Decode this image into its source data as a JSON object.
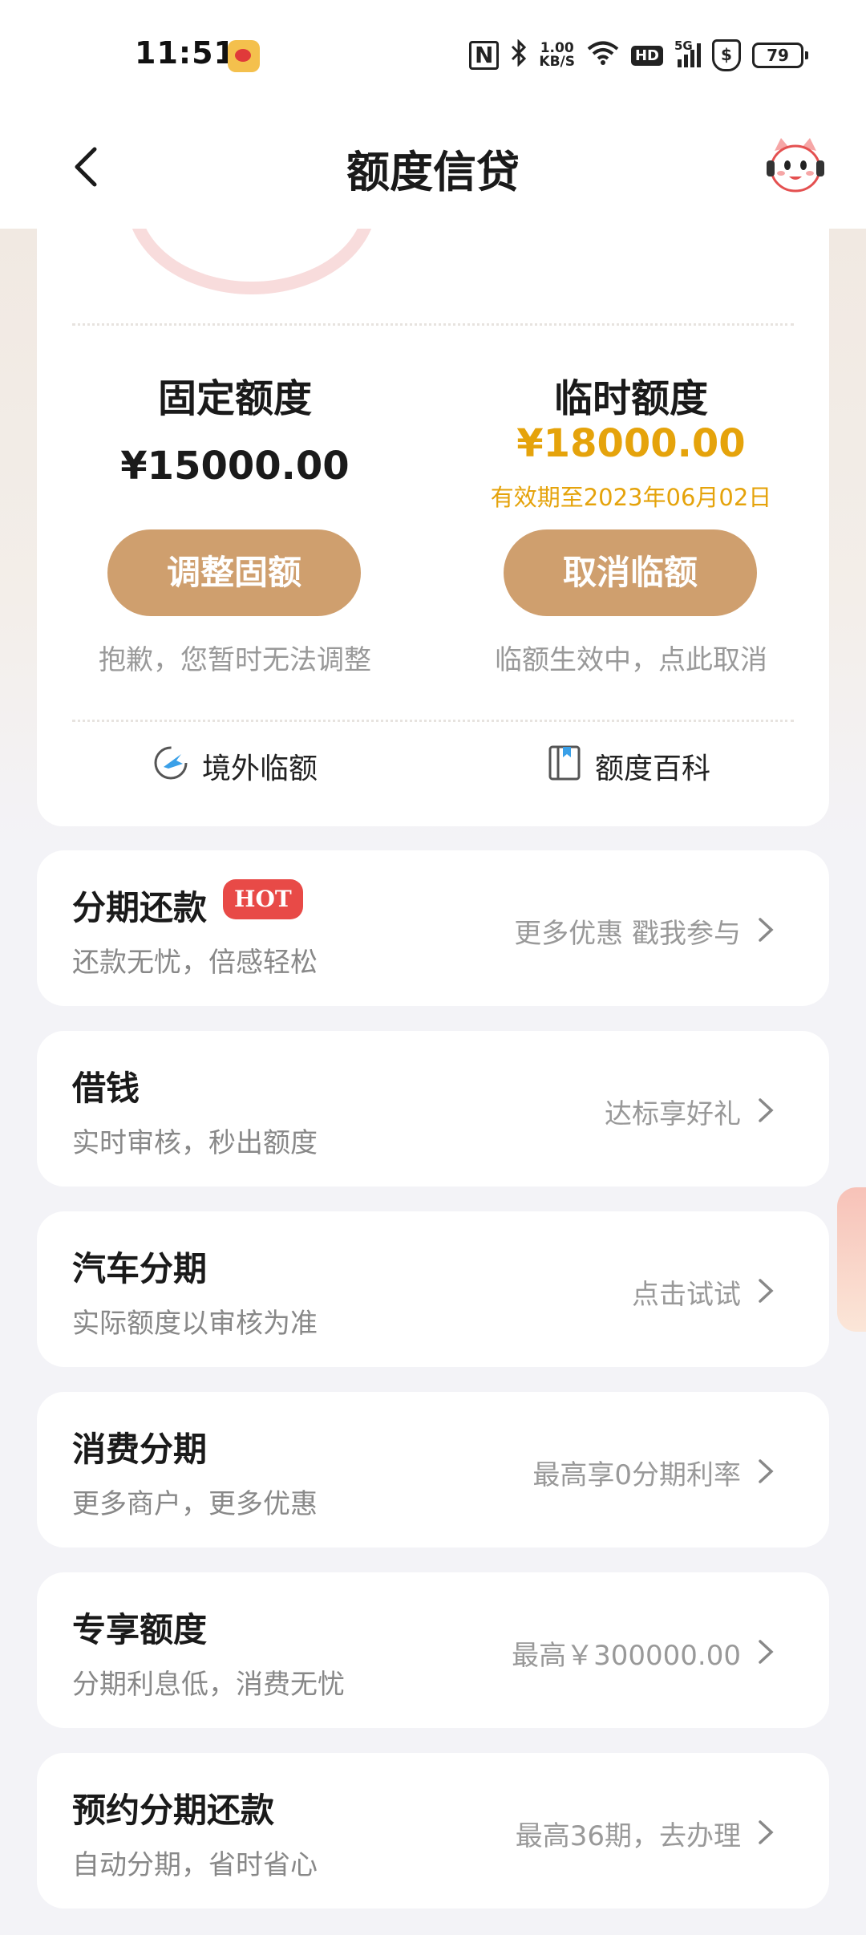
{
  "status_bar": {
    "time": "11:51",
    "net_speed_value": "1.00",
    "net_speed_unit": "KB/S",
    "hd": "HD",
    "network": "5G",
    "battery": "79"
  },
  "nav": {
    "title": "额度信贷"
  },
  "quota": {
    "fixed": {
      "label": "固定额度",
      "amount": "¥15000.00",
      "button": "调整固额",
      "hint": "抱歉，您暂时无法调整"
    },
    "temp": {
      "label": "临时额度",
      "amount": "¥18000.00",
      "valid": "有效期至2023年06月02日",
      "button": "取消临额",
      "hint": "临额生效中，点此取消"
    },
    "tools": [
      {
        "label": "境外临额",
        "icon": "plane-globe-icon"
      },
      {
        "label": "额度百科",
        "icon": "book-icon"
      }
    ]
  },
  "services": [
    {
      "title": "分期还款",
      "badge": "HOT",
      "subtitle": "还款无忧，倍感轻松",
      "action": "更多优惠 戳我参与"
    },
    {
      "title": "借钱",
      "subtitle": "实时审核，秒出额度",
      "action": "达标享好礼"
    },
    {
      "title": "汽车分期",
      "subtitle": "实际额度以审核为准",
      "action": "点击试试"
    },
    {
      "title": "消费分期",
      "subtitle": "更多商户，更多优惠",
      "action": "最高享0分期利率"
    },
    {
      "title": "专享额度",
      "subtitle": "分期利息低，消费无忧",
      "action": "最高￥300000.00"
    },
    {
      "title": "预约分期还款",
      "subtitle": "自动分期，省时省心",
      "action": "最高36期，去办理"
    }
  ],
  "colors": {
    "accent_button": "#cf9f6e",
    "gold_text": "#e5a30b",
    "hot_badge": "#e84a47"
  }
}
